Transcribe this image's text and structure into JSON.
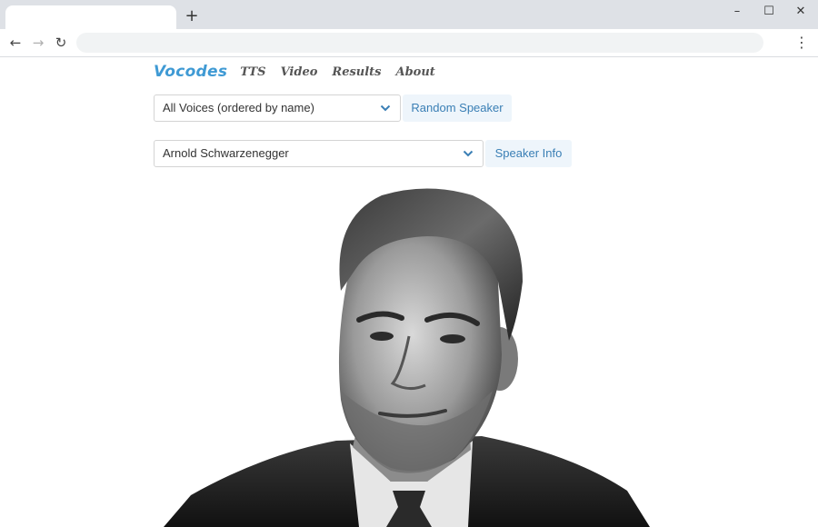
{
  "browser": {
    "new_tab_glyph": "+",
    "window_controls": {
      "minimize": "–",
      "maximize": "☐",
      "close": "✕"
    },
    "nav": {
      "back": "←",
      "forward": "→",
      "reload": "↻",
      "menu": "⋮"
    }
  },
  "site": {
    "logo": "Vocodes",
    "nav_links": [
      "TTS",
      "Video",
      "Results",
      "About"
    ],
    "accent_color": "#3f9ad4"
  },
  "voices_select": {
    "value": "All Voices (ordered by name)"
  },
  "random_button": {
    "label": "Random Speaker"
  },
  "speaker_select": {
    "value": "Arnold Schwarzenegger"
  },
  "info_button": {
    "label": "Speaker Info"
  }
}
